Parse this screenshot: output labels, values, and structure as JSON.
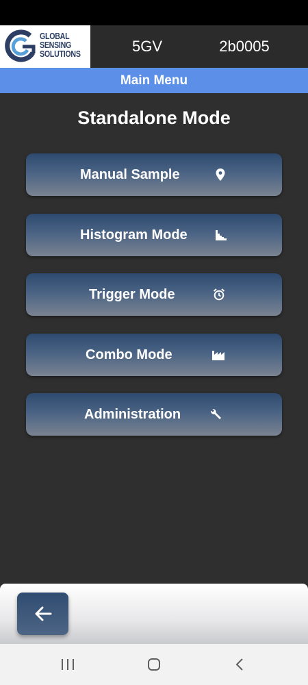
{
  "header": {
    "logo": {
      "lines": [
        "GLOBAL",
        "SENSING",
        "SOLUTIONS"
      ]
    },
    "model": "5GV",
    "serial": "2b0005"
  },
  "title_bar": "Main Menu",
  "page_title": "Standalone Mode",
  "menu": [
    {
      "label": "Manual Sample",
      "icon": "location-pin-icon"
    },
    {
      "label": "Histogram Mode",
      "icon": "histogram-icon"
    },
    {
      "label": "Trigger Mode",
      "icon": "alarm-clock-icon"
    },
    {
      "label": "Combo Mode",
      "icon": "factory-icon"
    },
    {
      "label": "Administration",
      "icon": "wrench-icon"
    }
  ],
  "bottom": {
    "back_icon": "arrow-left-icon"
  },
  "nav": {
    "icons": [
      "recent-apps-icon",
      "home-icon",
      "back-chevron-icon"
    ]
  },
  "colors": {
    "accent": "#5b8fe8",
    "background": "#2f2f2f",
    "button": "#3d5a7e"
  }
}
